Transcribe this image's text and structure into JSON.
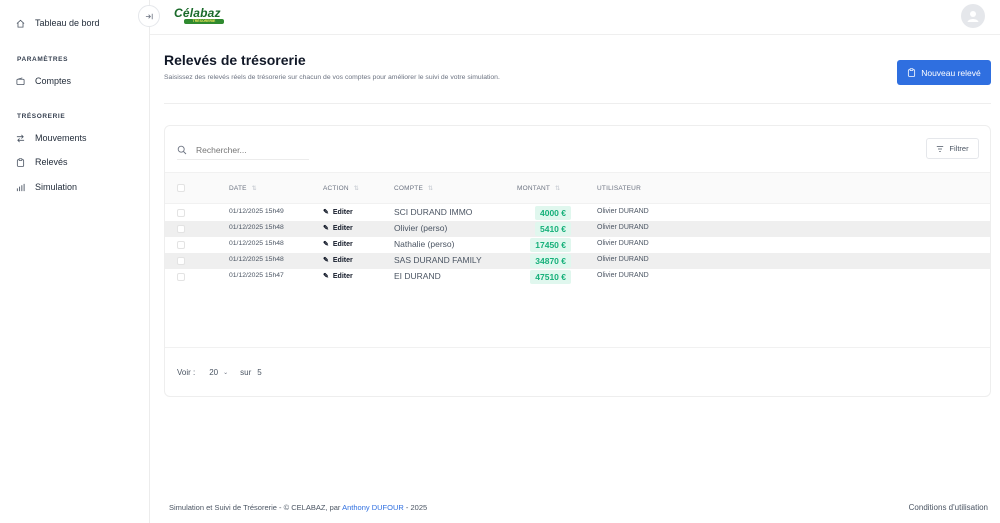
{
  "brand": {
    "logo_text": "Célabaz",
    "logo_sub": "TRÉSORERIE"
  },
  "sidebar": {
    "dashboard": {
      "label": "Tableau de bord",
      "icon": "home-icon"
    },
    "section_settings": "PARAMÈTRES",
    "accounts": {
      "label": "Comptes",
      "icon": "wallet-icon"
    },
    "section_treasury": "TRÉSORERIE",
    "movements": {
      "label": "Mouvements",
      "icon": "arrows-exchange-icon"
    },
    "statements": {
      "label": "Relevés",
      "icon": "clipboard-icon"
    },
    "simulation": {
      "label": "Simulation",
      "icon": "bar-chart-icon"
    }
  },
  "page": {
    "title": "Relevés de trésorerie",
    "subtitle": "Saisissez des relevés réels de trésorerie sur chacun de vos comptes pour améliorer le suivi de votre simulation.",
    "new_button": "Nouveau relevé"
  },
  "table": {
    "search_placeholder": "Rechercher...",
    "filter_label": "Filtrer",
    "columns": {
      "date": "DATE",
      "action": "ACTION",
      "compte": "COMPTE",
      "montant": "MONTANT",
      "utilisateur": "UTILISATEUR"
    },
    "rows": [
      {
        "date": "01/12/2025 15h49",
        "action": "Editer",
        "compte": "SCI DURAND IMMO",
        "montant": "4000 €",
        "utilisateur": "Olivier DURAND"
      },
      {
        "date": "01/12/2025 15h48",
        "action": "Editer",
        "compte": "Olivier (perso)",
        "montant": "5410 €",
        "utilisateur": "Olivier DURAND"
      },
      {
        "date": "01/12/2025 15h48",
        "action": "Editer",
        "compte": "Nathalie (perso)",
        "montant": "17450 €",
        "utilisateur": "Olivier DURAND"
      },
      {
        "date": "01/12/2025 15h48",
        "action": "Editer",
        "compte": "SAS DURAND FAMILY",
        "montant": "34870 €",
        "utilisateur": "Olivier DURAND"
      },
      {
        "date": "01/12/2025 15h47",
        "action": "Editer",
        "compte": "EI DURAND",
        "montant": "47510 €",
        "utilisateur": "Olivier DURAND"
      }
    ],
    "pagination": {
      "show_label": "Voir :",
      "page_size": "20",
      "of_label": "sur",
      "total": "5"
    }
  },
  "footer": {
    "text_before": "Simulation et Suivi de Trésorerie - © CELABAZ, par",
    "author": "Anthony DUFOUR",
    "text_after": "- 2025",
    "terms": "Conditions d'utilisation"
  },
  "colors": {
    "primary": "#2f6fe0",
    "amount_text": "#16b07a",
    "amount_bg": "#e0f7ee",
    "brand_green": "#1a6a2a"
  }
}
